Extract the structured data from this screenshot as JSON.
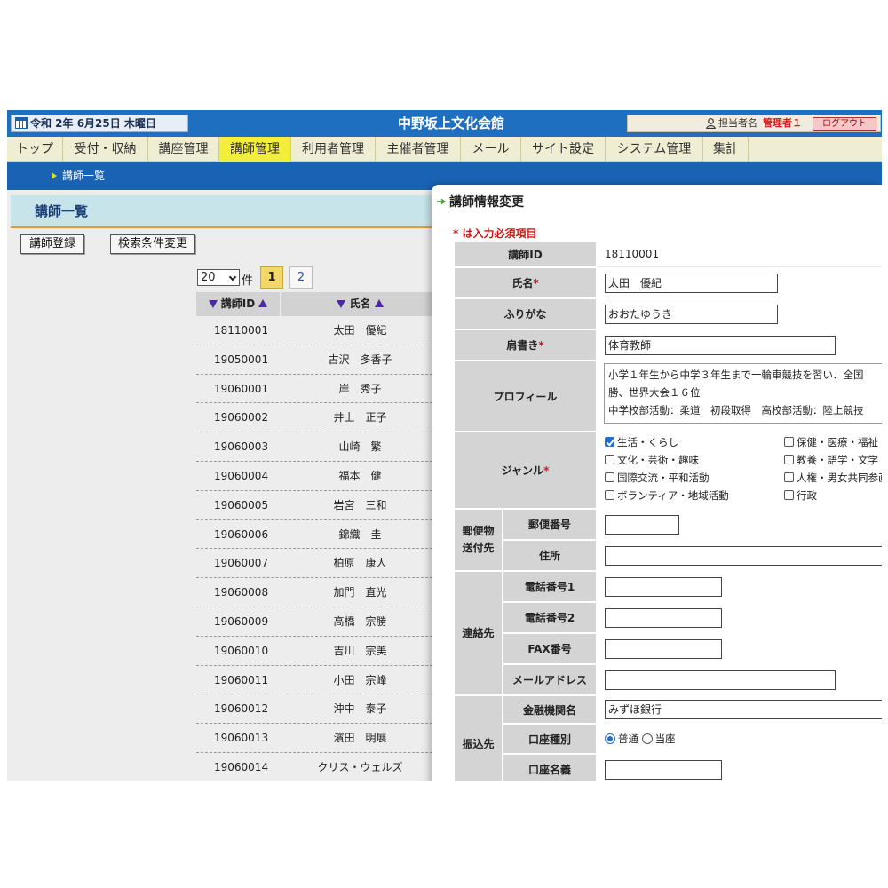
{
  "header": {
    "date": "令和 2年 6月25日 木曜日",
    "site_title": "中野坂上文化会館",
    "user_label": "担当者名",
    "user_name": "管理者１",
    "logout": "ログアウト"
  },
  "menu": [
    {
      "label": "トップ"
    },
    {
      "label": "受付・収納"
    },
    {
      "label": "講座管理"
    },
    {
      "label": "講師管理",
      "active": true
    },
    {
      "label": "利用者管理"
    },
    {
      "label": "主催者管理"
    },
    {
      "label": "メール"
    },
    {
      "label": "サイト設定"
    },
    {
      "label": "システム管理"
    },
    {
      "label": "集計"
    }
  ],
  "breadcrumb": "講師一覧",
  "list": {
    "title": "講師一覧",
    "register_button": "講師登録",
    "search_button": "検索条件変更",
    "page_size": "20",
    "page_size_unit": "件",
    "pages": [
      "1",
      "2"
    ],
    "col_id": "講師ID",
    "col_name": "氏名",
    "rows": [
      {
        "id": "18110001",
        "name": "太田　優紀"
      },
      {
        "id": "19050001",
        "name": "古沢　多香子"
      },
      {
        "id": "19060001",
        "name": "岸　秀子"
      },
      {
        "id": "19060002",
        "name": "井上　正子"
      },
      {
        "id": "19060003",
        "name": "山崎　繁"
      },
      {
        "id": "19060004",
        "name": "福本　健"
      },
      {
        "id": "19060005",
        "name": "岩宮　三和"
      },
      {
        "id": "19060006",
        "name": "錦織　圭"
      },
      {
        "id": "19060007",
        "name": "柏原　康人"
      },
      {
        "id": "19060008",
        "name": "加門　直光"
      },
      {
        "id": "19060009",
        "name": "高橋　宗勝"
      },
      {
        "id": "19060010",
        "name": "吉川　宗美"
      },
      {
        "id": "19060011",
        "name": "小田　宗峰"
      },
      {
        "id": "19060012",
        "name": "沖中　泰子"
      },
      {
        "id": "19060013",
        "name": "濱田　明展"
      },
      {
        "id": "19060014",
        "name": "クリス・ウェルズ"
      }
    ]
  },
  "dialog": {
    "title": "講師情報変更",
    "required_note": "* は入力必須項目",
    "labels": {
      "id": "講師ID",
      "name": "氏名",
      "furigana": "ふりがな",
      "title": "肩書き",
      "profile": "プロフィール",
      "genre": "ジャンル",
      "mail_group": "郵便物送付先",
      "postal": "郵便番号",
      "address": "住所",
      "contact_group": "連絡先",
      "phone1": "電話番号1",
      "phone2": "電話番号2",
      "fax": "FAX番号",
      "email": "メールアドレス",
      "bank_group": "振込先",
      "bank_name": "金融機関名",
      "account_type": "口座種別",
      "account_name": "口座名義"
    },
    "required_mark": "*",
    "values": {
      "id": "18110001",
      "name": "太田　優紀",
      "furigana": "おおたゆうき",
      "title": "体育教師",
      "profile_lines": [
        "小学１年生から中学３年生まで一輪車競技を習い、全国",
        "勝、世界大会１６位",
        "中学校部活動：柔道　初段取得　高校部活動：陸上競技"
      ],
      "bank_name": "みずほ銀行"
    },
    "genres": [
      {
        "label": "生活・くらし",
        "checked": true
      },
      {
        "label": "保健・医療・福祉",
        "checked": false
      },
      {
        "label": "文化・芸術・趣味",
        "checked": false
      },
      {
        "label": "教養・語学・文学",
        "checked": false
      },
      {
        "label": "国際交流・平和活動",
        "checked": false
      },
      {
        "label": "人権・男女共同参画",
        "checked": false
      },
      {
        "label": "ボランティア・地域活動",
        "checked": false
      },
      {
        "label": "行政",
        "checked": false
      }
    ],
    "account_types": [
      {
        "label": "普通",
        "checked": true
      },
      {
        "label": "当座",
        "checked": false
      }
    ]
  },
  "colors": {
    "topbar": "#1f6fc0",
    "menu_bg": "#f0eed2",
    "menu_active": "#f3ee3a",
    "subbar": "#1a63b4",
    "list_header_bg": "#c7e4ea",
    "sort_arrow": "#4e28a4",
    "required": "#d01818"
  }
}
